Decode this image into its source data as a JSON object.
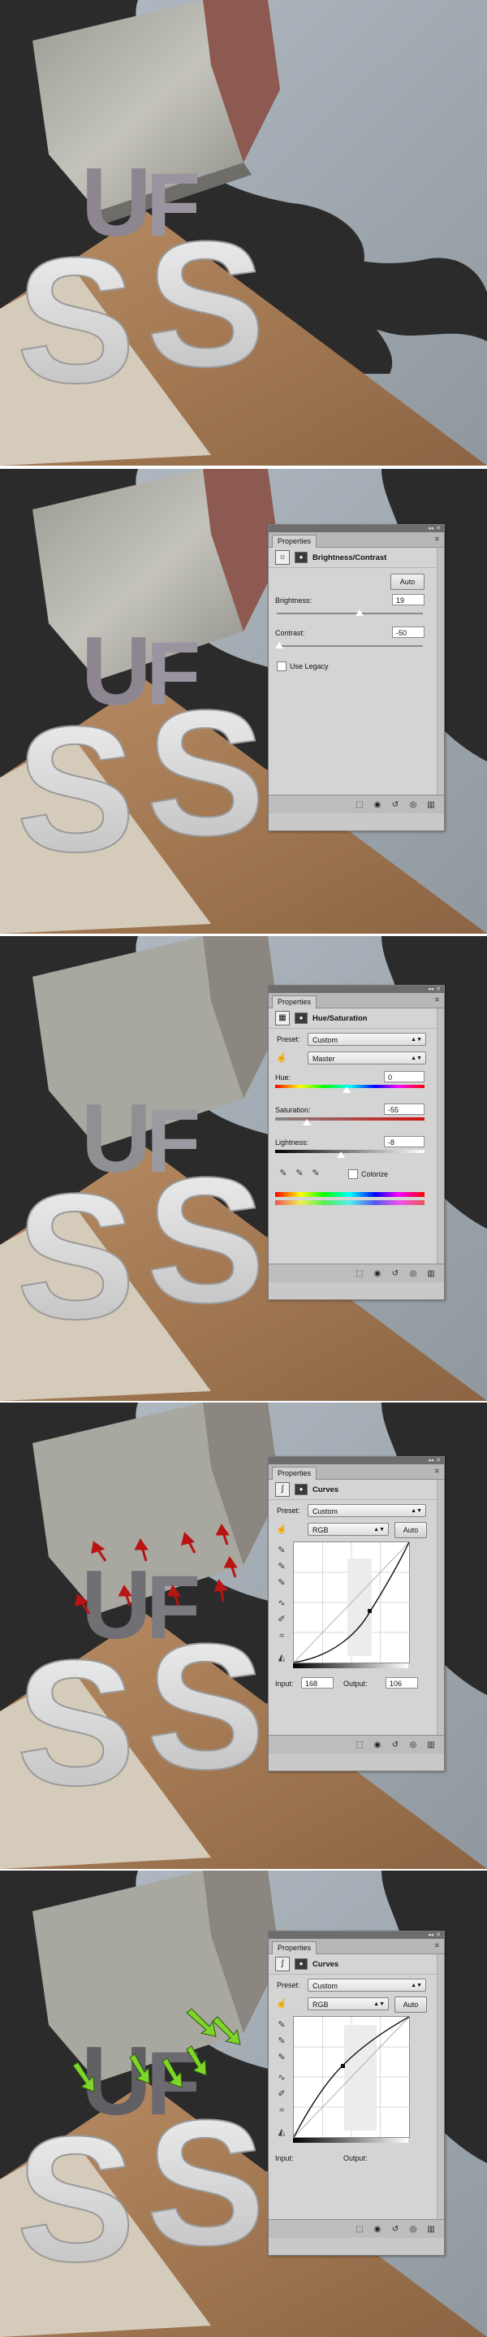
{
  "brightness_contrast": {
    "tab": "Properties",
    "title": "Brightness/Contrast",
    "auto": "Auto",
    "brightness_label": "Brightness:",
    "brightness_value": "19",
    "contrast_label": "Contrast:",
    "contrast_value": "-50",
    "legacy_label": "Use Legacy"
  },
  "hue_saturation": {
    "tab": "Properties",
    "title": "Hue/Saturation",
    "preset_label": "Preset:",
    "preset_value": "Custom",
    "channel_value": "Master",
    "hue_label": "Hue:",
    "hue_value": "0",
    "saturation_label": "Saturation:",
    "saturation_value": "-55",
    "lightness_label": "Lightness:",
    "lightness_value": "-8",
    "colorize_label": "Colorize"
  },
  "curves1": {
    "tab": "Properties",
    "title": "Curves",
    "preset_label": "Preset:",
    "preset_value": "Custom",
    "channel_value": "RGB",
    "auto": "Auto",
    "input_label": "Input:",
    "input_value": "168",
    "output_label": "Output:",
    "output_value": "106"
  },
  "curves2": {
    "tab": "Properties",
    "title": "Curves",
    "preset_label": "Preset:",
    "preset_value": "Custom",
    "channel_value": "RGB",
    "auto": "Auto",
    "input_label": "Input:",
    "output_label": "Output:"
  },
  "scene_text": {
    "letter_s": "S",
    "letter_u": "U",
    "letter_f": "F"
  },
  "colors": {
    "smoke": "#2b2b2b",
    "wall": "#a3acb3",
    "floor": "#a77c56",
    "red_arrow": "#b81414",
    "green_arrow": "#7fd52a"
  }
}
